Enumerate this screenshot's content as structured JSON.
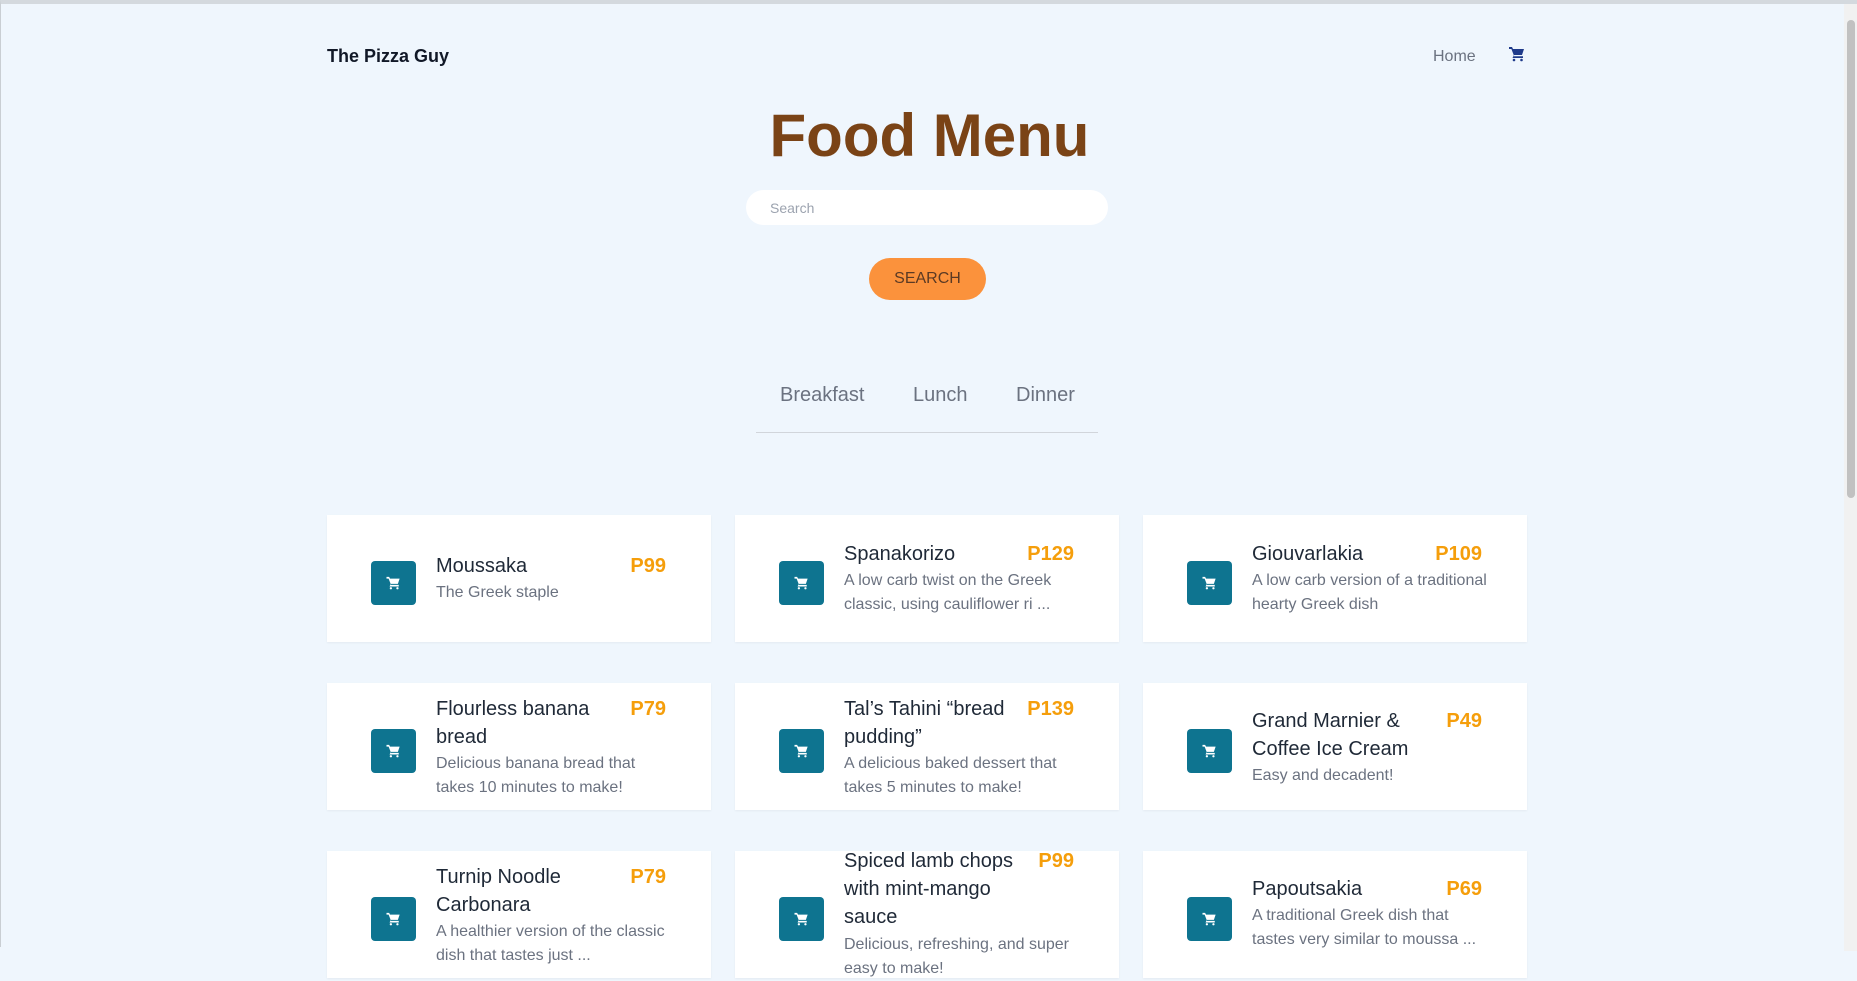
{
  "nav": {
    "brand": "The Pizza Guy",
    "home": "Home",
    "cart_icon": "cart-icon"
  },
  "header": {
    "title": "Food Menu"
  },
  "search": {
    "placeholder": "Search",
    "value": "",
    "button_label": "SEARCH"
  },
  "tabs": [
    "Breakfast",
    "Lunch",
    "Dinner"
  ],
  "colors": {
    "accent": "#fb923c",
    "price": "#f59e0b",
    "cart_button": "#0e7490",
    "title": "#7a4316",
    "background": "#eff6fd"
  },
  "items": [
    {
      "name": "Moussaka",
      "desc": "The Greek staple",
      "price": "P99"
    },
    {
      "name": "Spanakorizo",
      "desc": "A low carb twist on the Greek classic, using cauliflower ri ...",
      "price": "P129"
    },
    {
      "name": "Giouvarlakia",
      "desc": "A low carb version of a traditional hearty Greek dish",
      "price": "P109"
    },
    {
      "name": "Flourless banana bread",
      "desc": "Delicious banana bread that takes 10 minutes to make!",
      "price": "P79"
    },
    {
      "name": "Tal’s Tahini “bread pudding”",
      "desc": "A delicious baked dessert that takes 5 minutes to make!",
      "price": "P139"
    },
    {
      "name": "Grand Marnier & Coffee Ice Cream",
      "desc": "Easy and decadent!",
      "price": "P49"
    },
    {
      "name": "Turnip Noodle Carbonara",
      "desc": "A healthier version of the classic dish that tastes just ...",
      "price": "P79"
    },
    {
      "name": "Spiced lamb chops with mint-mango sauce",
      "desc": "Delicious, refreshing, and super easy to make!",
      "price": "P99"
    },
    {
      "name": "Papoutsakia",
      "desc": "A traditional Greek dish that tastes very similar to moussa ...",
      "price": "P69"
    }
  ]
}
